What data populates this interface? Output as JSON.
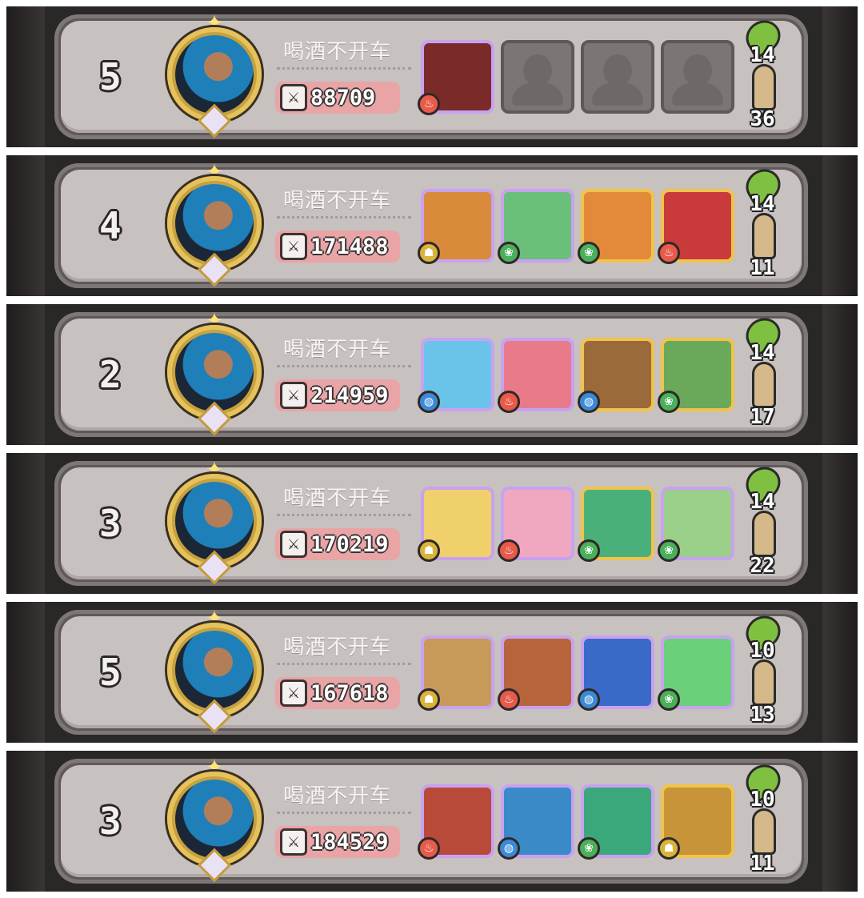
{
  "rows": [
    {
      "rank": "5",
      "name": "喝酒不开车",
      "power": "88709",
      "stat_a": "14",
      "stat_b": "36",
      "heroes": [
        {
          "icon": "bull-warrior-hero",
          "bg": "#7b2a2a",
          "frame": "#c8a2f0",
          "element": "fire"
        },
        {
          "icon": "empty-slot"
        },
        {
          "icon": "empty-slot"
        },
        {
          "icon": "empty-slot"
        }
      ]
    },
    {
      "rank": "4",
      "name": "喝酒不开车",
      "power": "171488",
      "stat_a": "14",
      "stat_b": "11",
      "heroes": [
        {
          "icon": "tiger-hero",
          "bg": "#d98a3a",
          "frame": "#c8a2f0",
          "element": "earth"
        },
        {
          "icon": "green-sorceress-hero",
          "bg": "#6abf7a",
          "frame": "#c8a2f0",
          "element": "wind"
        },
        {
          "icon": "orange-haired-girl-hero",
          "bg": "#e38a3a",
          "frame": "#f0c34a",
          "element": "wind"
        },
        {
          "icon": "red-haired-monocle-hero",
          "bg": "#c93a3a",
          "frame": "#f0c34a",
          "element": "fire"
        }
      ]
    },
    {
      "rank": "2",
      "name": "喝酒不开车",
      "power": "214959",
      "stat_a": "14",
      "stat_b": "17",
      "heroes": [
        {
          "icon": "blue-elf-archer-hero",
          "bg": "#6ac3e8",
          "frame": "#c8a2f0",
          "element": "water"
        },
        {
          "icon": "pink-haired-girl-hero",
          "bg": "#e87a8a",
          "frame": "#c8a2f0",
          "element": "fire"
        },
        {
          "icon": "wooden-mask-hero",
          "bg": "#9a6a3a",
          "frame": "#f0c34a",
          "element": "water"
        },
        {
          "icon": "green-haired-warrior-hero",
          "bg": "#6aa85a",
          "frame": "#f0c34a",
          "element": "wind"
        }
      ]
    },
    {
      "rank": "3",
      "name": "喝酒不开车",
      "power": "170219",
      "stat_a": "14",
      "stat_b": "22",
      "heroes": [
        {
          "icon": "blonde-girl-hero",
          "bg": "#f0d06a",
          "frame": "#c8a2f0",
          "element": "earth"
        },
        {
          "icon": "pink-fairy-hero",
          "bg": "#f0a8c0",
          "frame": "#c8a2f0",
          "element": "fire"
        },
        {
          "icon": "green-druid-hero",
          "bg": "#4ab07a",
          "frame": "#f0c34a",
          "element": "wind"
        },
        {
          "icon": "old-sage-hero",
          "bg": "#9ad08a",
          "frame": "#c8a2f0",
          "element": "wind"
        }
      ]
    },
    {
      "rank": "5",
      "name": "喝酒不开车",
      "power": "167618",
      "stat_a": "10",
      "stat_b": "13",
      "heroes": [
        {
          "icon": "golden-crown-hero",
          "bg": "#c89a5a",
          "frame": "#c8a2f0",
          "element": "earth"
        },
        {
          "icon": "red-bandana-hero",
          "bg": "#b8643a",
          "frame": "#c8a2f0",
          "element": "fire"
        },
        {
          "icon": "blue-horned-hero",
          "bg": "#3a6ac8",
          "frame": "#c8a2f0",
          "element": "water"
        },
        {
          "icon": "green-elf-girl-hero",
          "bg": "#6ad07a",
          "frame": "#c8a2f0",
          "element": "wind"
        }
      ]
    },
    {
      "rank": "3",
      "name": "喝酒不开车",
      "power": "184529",
      "stat_a": "10",
      "stat_b": "11",
      "heroes": [
        {
          "icon": "goggles-red-hero",
          "bg": "#b84a3a",
          "frame": "#c8a2f0",
          "element": "fire"
        },
        {
          "icon": "blue-haired-rogue-hero",
          "bg": "#3a8ac8",
          "frame": "#c8a2f0",
          "element": "water"
        },
        {
          "icon": "green-medusa-hero",
          "bg": "#3aa87a",
          "frame": "#c8a2f0",
          "element": "wind"
        },
        {
          "icon": "aviator-girl-hero",
          "bg": "#c8943a",
          "frame": "#f0c34a",
          "element": "earth"
        }
      ]
    }
  ],
  "element_colors": {
    "fire": "#e85a4a",
    "water": "#3a8ad8",
    "wind": "#4ab05a",
    "earth": "#d8b43a"
  },
  "element_glyphs": {
    "fire": "♨",
    "water": "◍",
    "wind": "❀",
    "earth": "☗"
  }
}
